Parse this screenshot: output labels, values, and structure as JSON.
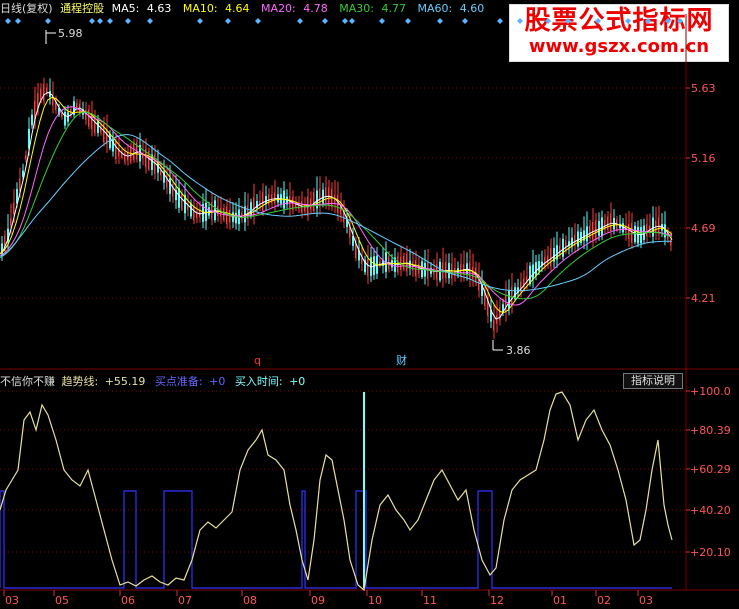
{
  "header": {
    "period": "日线(复权)",
    "name": "通程控股",
    "ma": [
      {
        "label": "MA5:",
        "value": "4.63",
        "color": "#ffffff"
      },
      {
        "label": "MA10:",
        "value": "4.64",
        "color": "#ffff00"
      },
      {
        "label": "MA20:",
        "value": "4.78",
        "color": "#ff66ff"
      },
      {
        "label": "MA30:",
        "value": "4.77",
        "color": "#33cc33"
      },
      {
        "label": "MA60:",
        "value": "4.60",
        "color": "#66ccff"
      }
    ]
  },
  "watermark": {
    "line1": "股票公式指标网",
    "line2": "www.gszx.com.cn"
  },
  "price_axis": [
    "5.63",
    "5.16",
    "4.69",
    "4.21"
  ],
  "markers": {
    "high": "5.98",
    "low": "3.86",
    "q": "q",
    "cai": "财"
  },
  "indicator": {
    "name": "不信你不赚",
    "trend_label": "趋势线:",
    "trend_value": "+55.19",
    "buy_label": "买点准备:",
    "buy_value": "+0",
    "time_label": "买入时间:",
    "time_value": "+0",
    "help_button": "指标说明",
    "axis": [
      "+100.0",
      "+80.39",
      "+60.29",
      "+40.20",
      "+20.10"
    ]
  },
  "x_axis": [
    "03",
    "05",
    "06",
    "07",
    "08",
    "09",
    "10",
    "11",
    "12",
    "01",
    "02",
    "03"
  ],
  "colors": {
    "up": "#ff3b3b",
    "down": "#54fcfc",
    "trend": "#e8e0a0",
    "buy": "#3333ff",
    "time": "#77ffff",
    "grid": "#800000"
  }
}
